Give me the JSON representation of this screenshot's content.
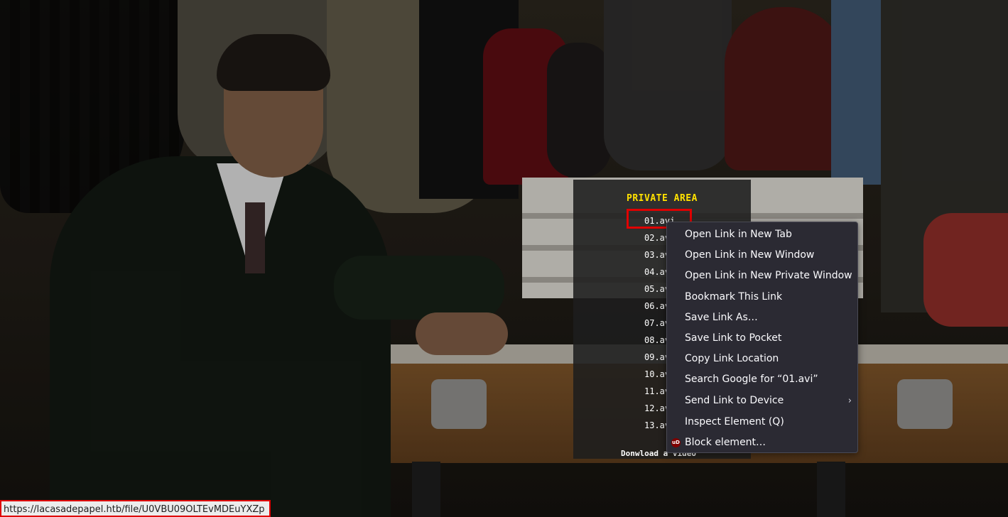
{
  "private_area": {
    "title": "PRIVATE AREA",
    "files": [
      "01.avi",
      "02.avi",
      "03.avi",
      "04.avi",
      "05.avi",
      "06.avi",
      "07.avi",
      "08.avi",
      "09.avi",
      "10.avi",
      "11.avi",
      "12.avi",
      "13.avi"
    ],
    "footer": "Donwload a video"
  },
  "context_menu": {
    "items": [
      {
        "label": "Open Link in New Tab"
      },
      {
        "label": "Open Link in New Window"
      },
      {
        "label": "Open Link in New Private Window"
      },
      {
        "label": "Bookmark This Link"
      },
      {
        "label": "Save Link As…"
      },
      {
        "label": "Save Link to Pocket"
      },
      {
        "label": "Copy Link Location"
      },
      {
        "label": "Search Google for “01.avi”"
      },
      {
        "label": "Send Link to Device",
        "submenu": "›"
      },
      {
        "label": "Inspect Element (Q)"
      },
      {
        "label": "Block element…",
        "icon": "ublock-origin-icon",
        "icon_text": "uD"
      }
    ]
  },
  "status_bar": {
    "url": "https://lacasadepapel.htb/file/U0VBU09OLTEvMDEuYXZp"
  },
  "colors": {
    "title_yellow": "#ffe100",
    "highlight_red": "#e00000",
    "menu_bg": "#2b2a33"
  }
}
